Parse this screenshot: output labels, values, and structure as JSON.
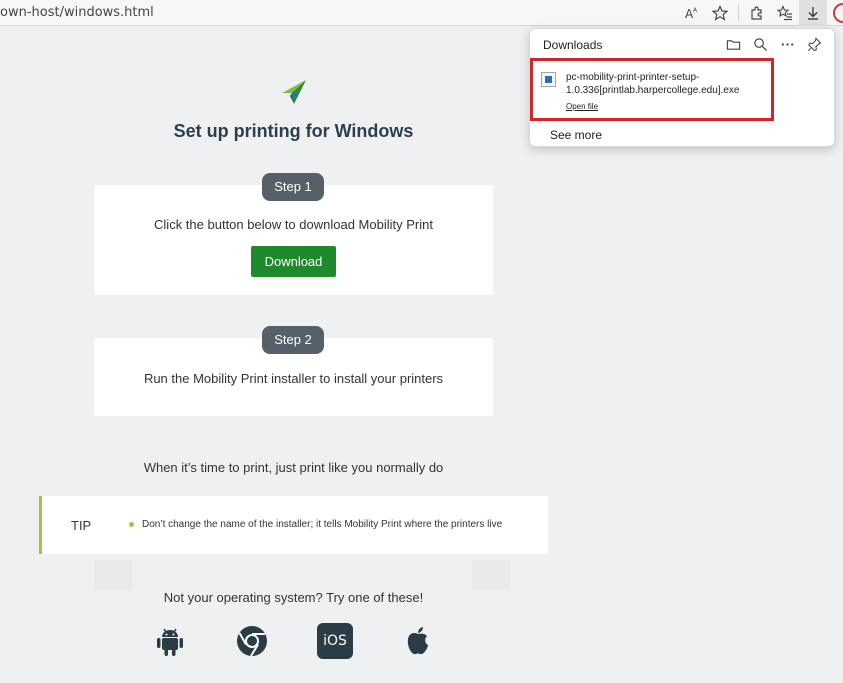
{
  "browser": {
    "url": "own-host/windows.html",
    "icons": [
      "read-aloud-icon",
      "favorite-star-icon",
      "extensions-icon",
      "favorites-list-icon",
      "downloads-icon"
    ]
  },
  "page": {
    "title": "Set up printing for Windows",
    "step1": {
      "label": "Step 1",
      "text": "Click the button below to download Mobility Print",
      "button": "Download"
    },
    "step2": {
      "label": "Step 2",
      "text": "Run the Mobility Print installer to install your printers"
    },
    "print_line": "When it’s time to print, just print like you normally do",
    "tip": {
      "label": "TIP",
      "text": "Don’t change the name of the installer; it tells Mobility Print where the printers live"
    },
    "other_os": "Not your operating system? Try one of these!",
    "os_options": [
      "android-icon",
      "chrome-icon",
      "ios-icon",
      "apple-icon"
    ],
    "ios_label": "iOS",
    "colors": {
      "accent_green": "#1f8a2b",
      "tip_bar": "#a6c43a",
      "pill": "#566069"
    }
  },
  "downloads": {
    "title": "Downloads",
    "file_name_line1": "pc-mobility-print-printer-setup-",
    "file_name_line2": "1.0.336[printlab.harpercollege.edu].exe",
    "open_file": "Open file",
    "see_more": "See more",
    "highlight_color": "#d0262b"
  }
}
